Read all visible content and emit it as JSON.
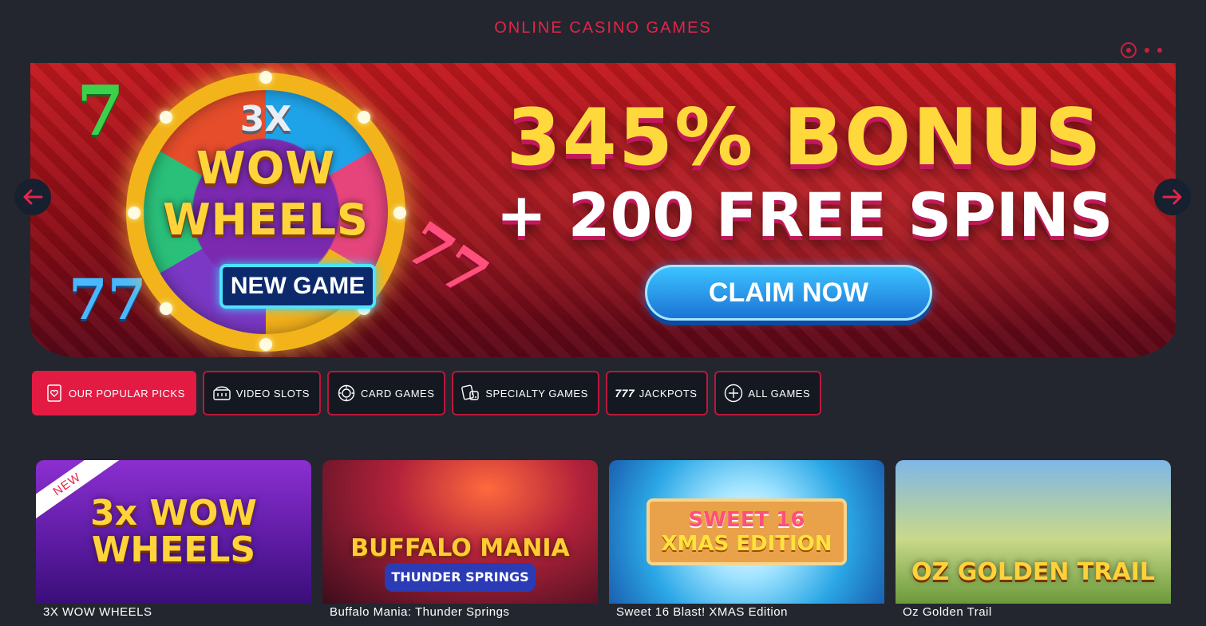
{
  "page": {
    "title": "ONLINE CASINO GAMES"
  },
  "carousel": {
    "slide_count": 3,
    "active_index": 0,
    "banner": {
      "logo_line1": "3X",
      "logo_line2": "WOW",
      "logo_line3": "WHEELS",
      "tag": "NEW GAME",
      "headline": "345% BONUS",
      "subheadline": "+ 200 FREE SPINS",
      "cta": "CLAIM NOW"
    },
    "prev_icon": "arrow-left-icon",
    "next_icon": "arrow-right-icon"
  },
  "filters": [
    {
      "label": "OUR POPULAR PICKS",
      "icon": "heart-card-icon",
      "active": true
    },
    {
      "label": "VIDEO SLOTS",
      "icon": "slot-machine-icon",
      "active": false
    },
    {
      "label": "CARD GAMES",
      "icon": "poker-chip-icon",
      "active": false
    },
    {
      "label": "SPECIALTY GAMES",
      "icon": "dice-cards-icon",
      "active": false
    },
    {
      "label": "JACKPOTS",
      "icon": "sevens-icon",
      "active": false
    },
    {
      "label": "ALL GAMES",
      "icon": "plus-circle-icon",
      "active": false
    }
  ],
  "games": [
    {
      "name": "3X WOW WHEELS",
      "badge": "NEW",
      "art": "3x WOW WHEELS"
    },
    {
      "name": "Buffalo Mania: Thunder Springs",
      "art": "BUFFALO MANIA",
      "art_sub": "THUNDER SPRINGS"
    },
    {
      "name": "Sweet 16 Blast! XMAS Edition",
      "art": "SWEET 16",
      "art_sub": "XMAS EDITION"
    },
    {
      "name": "Oz Golden Trail",
      "art": "OZ GOLDEN TRAIL"
    }
  ],
  "colors": {
    "accent": "#e31b43",
    "background": "#23262e",
    "button_blue": "#1b74d6"
  }
}
